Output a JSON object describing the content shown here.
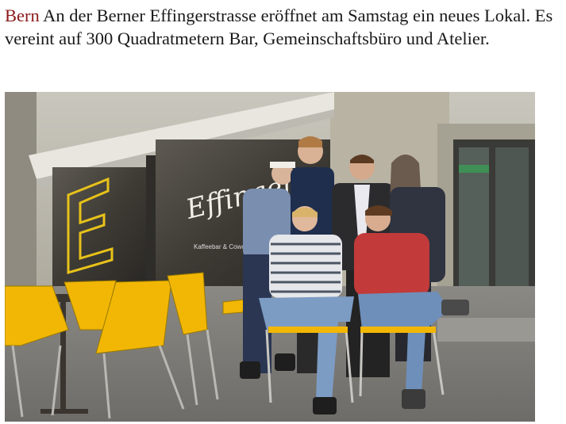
{
  "article": {
    "dateline": "Bern",
    "lead": " An der Berner Effingerstrasse eröffnet am Samstag ein neues Lokal. Es vereint auf 300 Quadratmetern Bar, Gemeinschaftsbüro und Atelier."
  },
  "photo": {
    "window_sign": "Effinger",
    "window_subtitle": "Kaffeebar & Cowo"
  },
  "colors": {
    "dateline": "#8b1a1a",
    "chairs": "#f2b705",
    "facade": "#b9b5a6"
  }
}
